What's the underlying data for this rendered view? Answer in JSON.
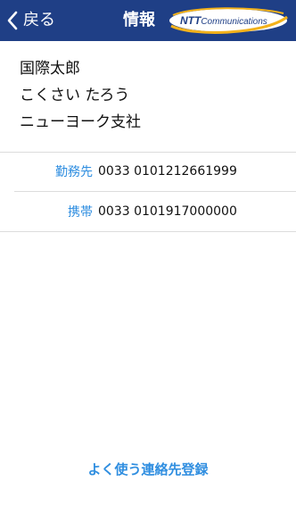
{
  "navbar": {
    "back_label": "戻る",
    "title": "情報",
    "logo": {
      "brand": "NTT",
      "suffix": "Communications"
    }
  },
  "contact": {
    "name": "国際太郎",
    "reading": "こくさい たろう",
    "department": "ニューヨーク支社",
    "phones": [
      {
        "label": "勤務先",
        "number": "0033 0101212661999"
      },
      {
        "label": "携帯",
        "number": "0033 0101917000000"
      }
    ]
  },
  "actions": {
    "add_favorite": "よく使う連絡先登録"
  },
  "colors": {
    "navbar": "#1f3f86",
    "accent": "#2f8ee0",
    "logo_ring": "#f3b21b"
  }
}
